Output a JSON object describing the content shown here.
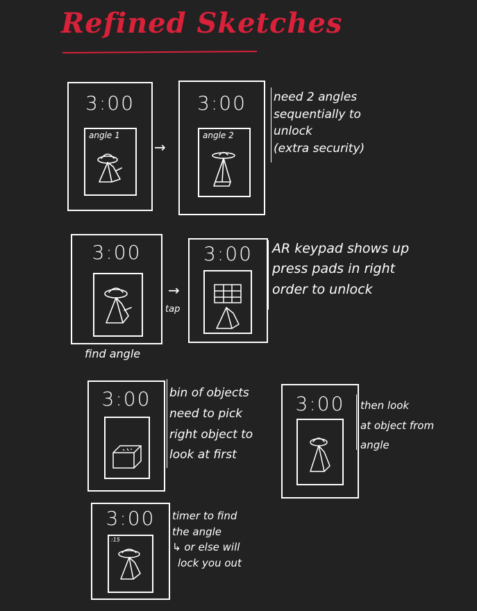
{
  "title": "Refined Sketches",
  "colors": {
    "background": "#222222",
    "title": "#d9213a",
    "ink": "#ffffff"
  },
  "row1": {
    "phone_a": {
      "time": "3:00",
      "label": "angle 1"
    },
    "arrow": "→",
    "phone_b": {
      "time": "3:00",
      "label": "angle 2"
    },
    "note": [
      "need 2 angles",
      "sequentially to",
      "unlock",
      "(extra security)"
    ]
  },
  "row2": {
    "phone_a": {
      "time": "3:00"
    },
    "caption": "find angle",
    "arrow": "→",
    "arrow_label": "tap",
    "phone_b": {
      "time": "3:00"
    },
    "note": [
      "AR keypad shows up",
      "press pads in right",
      "order to unlock"
    ]
  },
  "row3": {
    "phone_a": {
      "time": "3:00"
    },
    "note_a": [
      "bin of objects",
      "need to pick",
      "right object to",
      "look at first"
    ],
    "phone_b": {
      "time": "3:00"
    },
    "note_b": [
      "then look",
      "at object from",
      "angle"
    ]
  },
  "row4": {
    "phone": {
      "time": "3:00",
      "timer": ":15"
    },
    "note": [
      "timer to find",
      "the angle",
      "↳ or else will",
      "lock you out"
    ]
  },
  "icons": {
    "object": "hat-figure-icon",
    "keypad": "keypad-grid-icon",
    "bin": "bin-box-icon"
  }
}
